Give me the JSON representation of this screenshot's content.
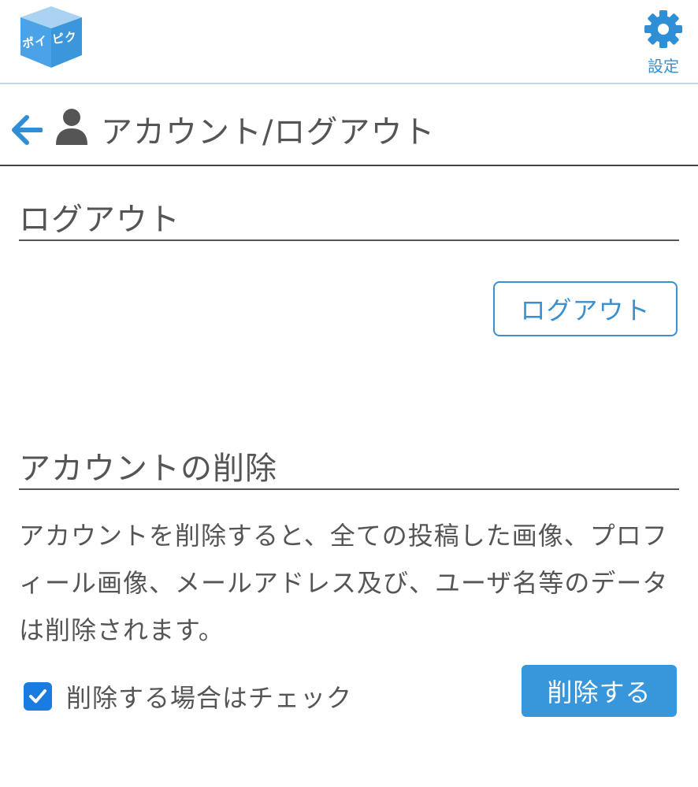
{
  "header": {
    "logo_text": "ポイ ピク",
    "settings_label": "設定",
    "settings_icon": "gear-icon"
  },
  "page": {
    "title": "アカウント/ログアウト",
    "back_icon": "arrow-left-icon",
    "user_icon": "user-icon"
  },
  "logout": {
    "heading": "ログアウト",
    "button_label": "ログアウト"
  },
  "delete": {
    "heading": "アカウントの削除",
    "description": "アカウントを削除すると、全ての投稿した画像、プロフィール画像、メールアドレス及び、ユーザ名等のデータは削除されます。",
    "checkbox_label": "削除する場合はチェック",
    "checkbox_checked": true,
    "button_label": "削除する"
  },
  "colors": {
    "accent": "#3a8fd0",
    "button_fill": "#3896db",
    "checkbox_fill": "#1a7be0",
    "text": "#555555"
  }
}
